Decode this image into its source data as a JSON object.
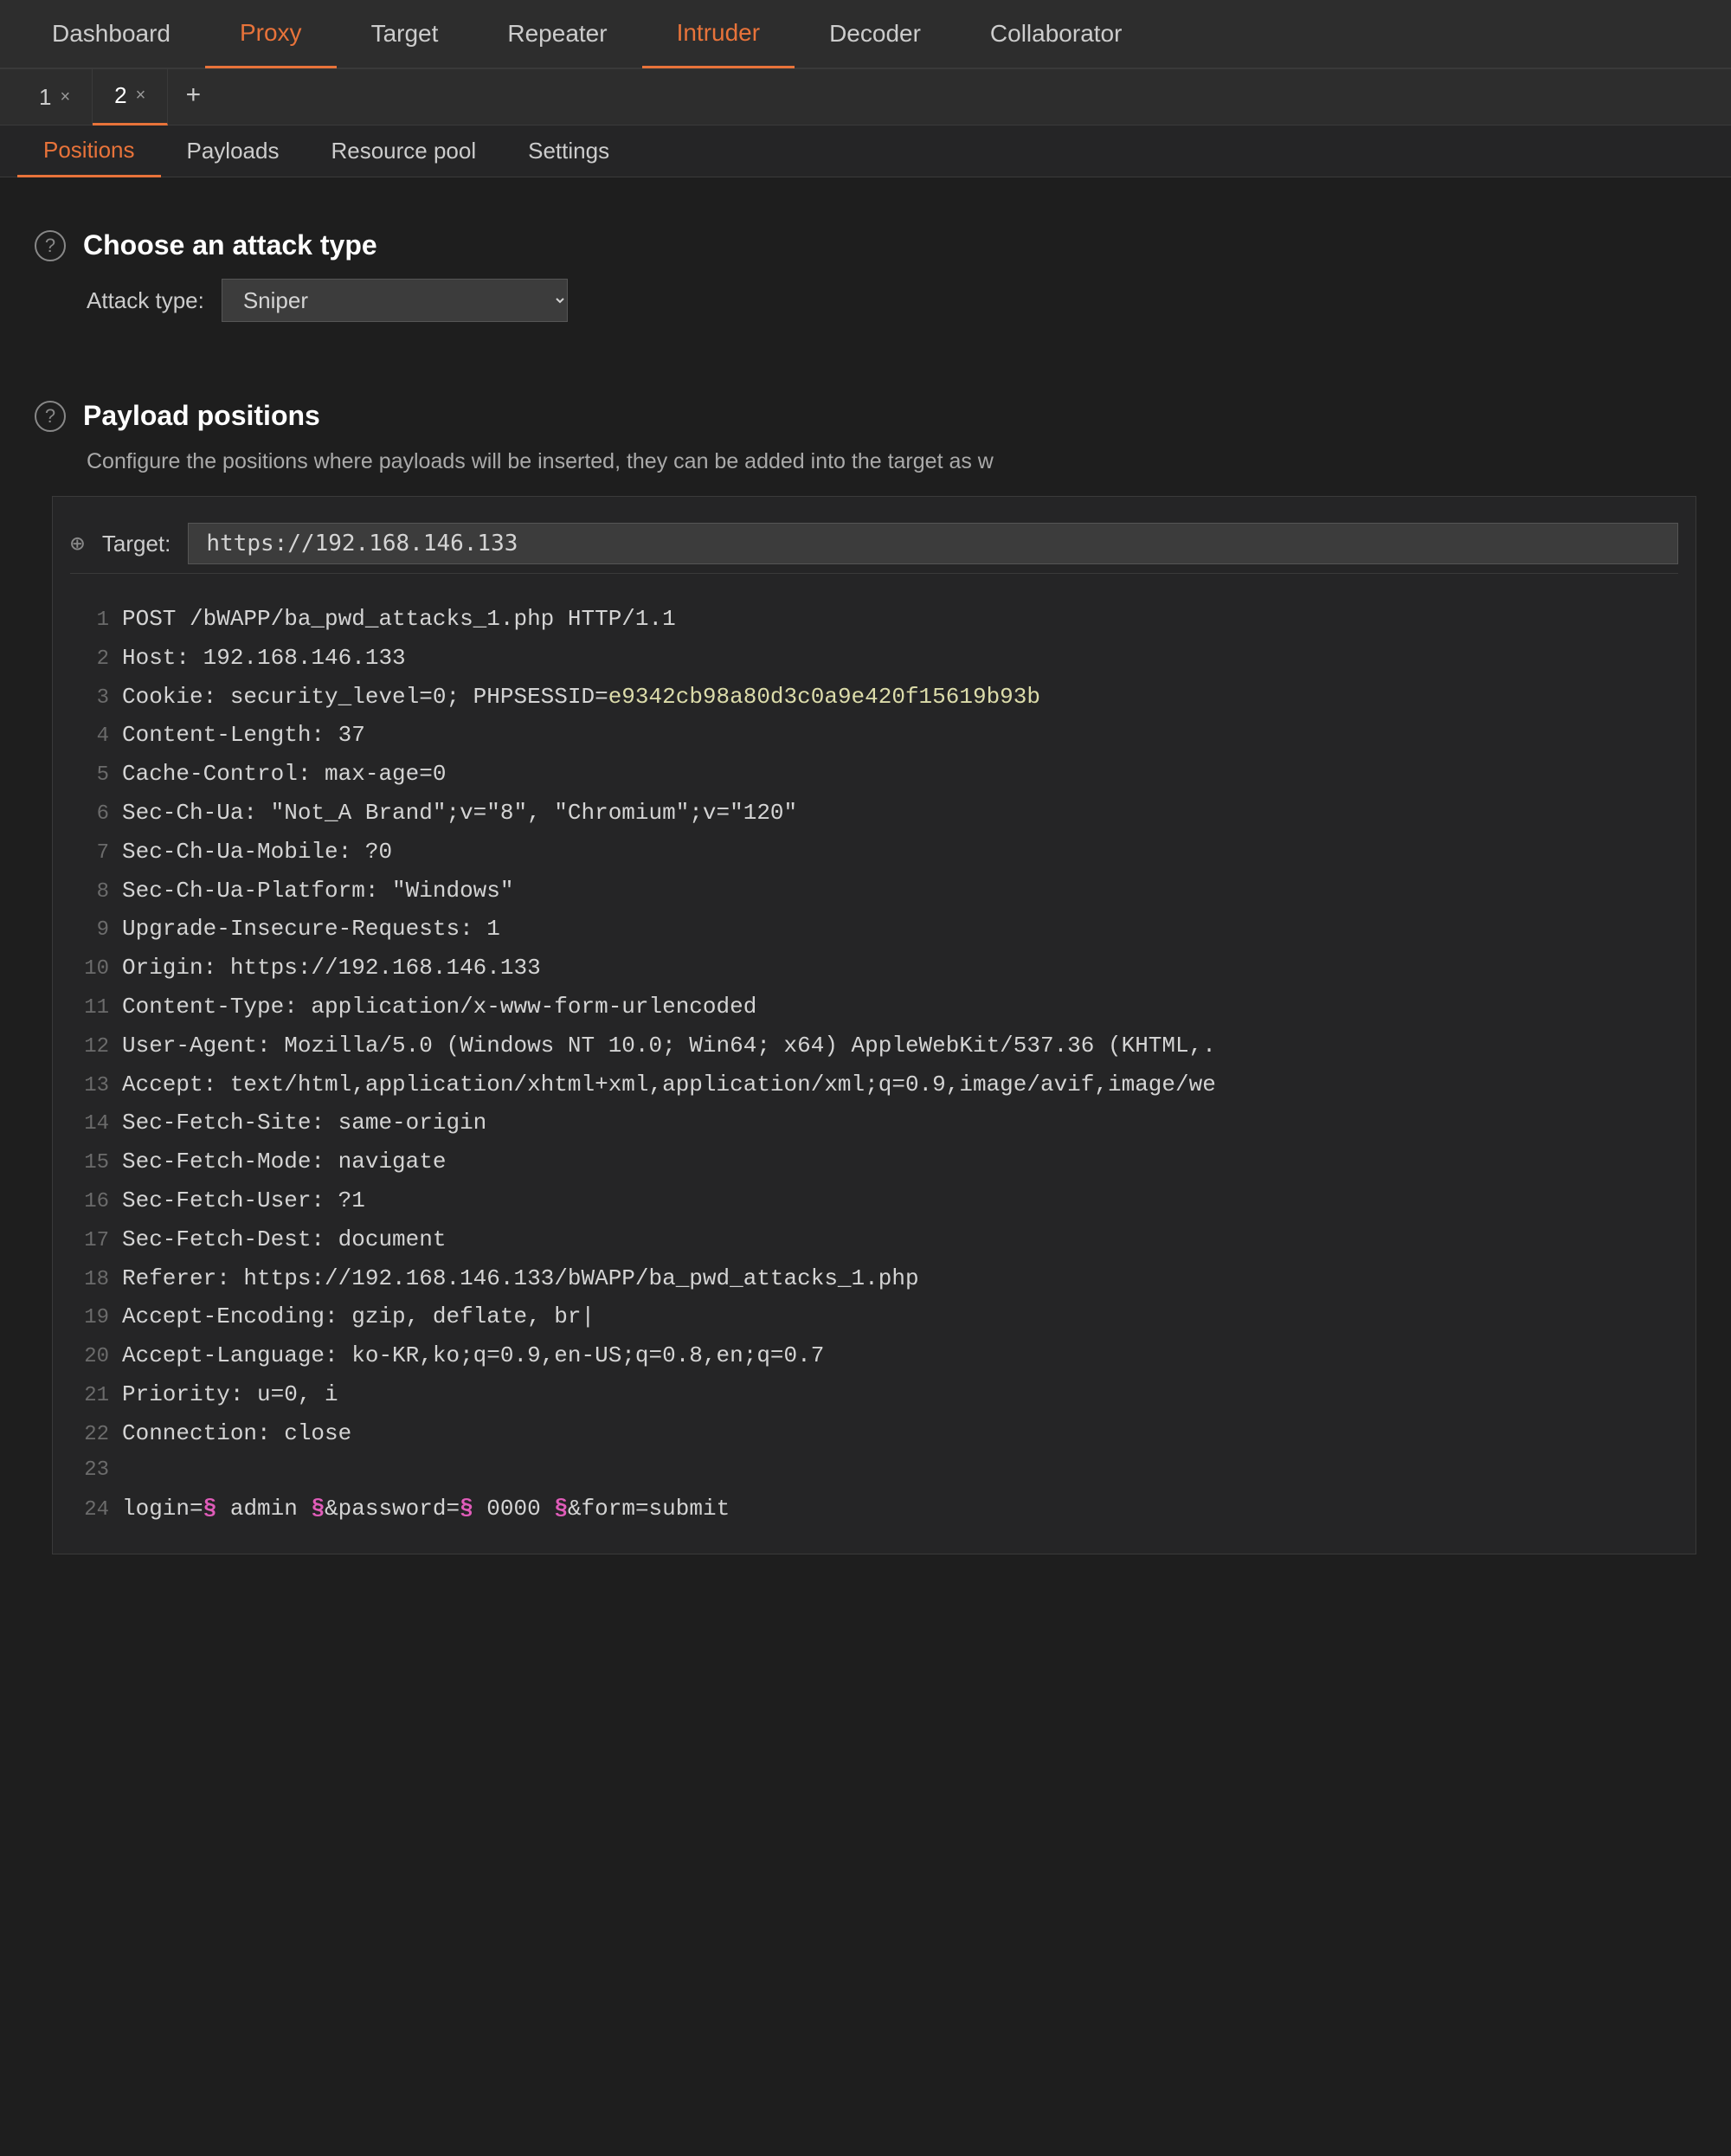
{
  "nav": {
    "items": [
      {
        "label": "Dashboard",
        "active": false
      },
      {
        "label": "Proxy",
        "active": true
      },
      {
        "label": "Target",
        "active": false
      },
      {
        "label": "Repeater",
        "active": false
      },
      {
        "label": "Intruder",
        "active": false
      },
      {
        "label": "Decoder",
        "active": false
      },
      {
        "label": "Collaborator",
        "active": false
      }
    ]
  },
  "tabs": {
    "items": [
      {
        "label": "1",
        "active": false
      },
      {
        "label": "2",
        "active": true
      }
    ],
    "add_label": "+"
  },
  "subtabs": {
    "items": [
      {
        "label": "Positions",
        "active": true
      },
      {
        "label": "Payloads",
        "active": false
      },
      {
        "label": "Resource pool",
        "active": false
      },
      {
        "label": "Settings",
        "active": false
      }
    ]
  },
  "attack_type": {
    "section_title": "Choose an attack type",
    "label": "Attack type:",
    "value": "Sniper"
  },
  "payload_positions": {
    "section_title": "Payload positions",
    "description": "Configure the positions where payloads will be inserted, they can be added into the target as w",
    "target": {
      "label": "Target:",
      "value": "https://192.168.146.133"
    },
    "request_lines": [
      {
        "num": "1",
        "text": "POST /bWAPP/ba_pwd_attacks_1.php HTTP/1.1",
        "type": "plain"
      },
      {
        "num": "2",
        "text": "Host: 192.168.146.133",
        "type": "plain"
      },
      {
        "num": "3",
        "text": "Cookie: security_level=0; PHPSESSID=",
        "suffix": "e9342cb98a80d3c0a9e420f15619b93b",
        "type": "cookie"
      },
      {
        "num": "4",
        "text": "Content-Length: 37",
        "type": "plain"
      },
      {
        "num": "5",
        "text": "Cache-Control: max-age=0",
        "type": "plain"
      },
      {
        "num": "6",
        "text": "Sec-Ch-Ua: \"Not_A Brand\";v=\"8\", \"Chromium\";v=\"120\"",
        "type": "plain"
      },
      {
        "num": "7",
        "text": "Sec-Ch-Ua-Mobile: ?0",
        "type": "plain"
      },
      {
        "num": "8",
        "text": "Sec-Ch-Ua-Platform: \"Windows\"",
        "type": "plain"
      },
      {
        "num": "9",
        "text": "Upgrade-Insecure-Requests: 1",
        "type": "plain"
      },
      {
        "num": "10",
        "text": "Origin: https://192.168.146.133",
        "type": "plain"
      },
      {
        "num": "11",
        "text": "Content-Type: application/x-www-form-urlencoded",
        "type": "plain"
      },
      {
        "num": "12",
        "text": "User-Agent: Mozilla/5.0 (Windows NT 10.0; Win64; x64) AppleWebKit/537.36 (KHTML,.",
        "type": "plain"
      },
      {
        "num": "13",
        "text": "Accept: text/html,application/xhtml+xml,application/xml;q=0.9,image/avif,image/we",
        "type": "plain"
      },
      {
        "num": "14",
        "text": "Sec-Fetch-Site: same-origin",
        "type": "plain"
      },
      {
        "num": "15",
        "text": "Sec-Fetch-Mode: navigate",
        "type": "plain"
      },
      {
        "num": "16",
        "text": "Sec-Fetch-User: ?1",
        "type": "plain"
      },
      {
        "num": "17",
        "text": "Sec-Fetch-Dest: document",
        "type": "plain"
      },
      {
        "num": "18",
        "text": "Referer: https://192.168.146.133/bWAPP/ba_pwd_attacks_1.php",
        "type": "plain"
      },
      {
        "num": "19",
        "text": "Accept-Encoding: gzip, deflate, br|",
        "type": "plain"
      },
      {
        "num": "20",
        "text": "Accept-Language: ko-KR,ko;q=0.9,en-US;q=0.8,en;q=0.7",
        "type": "plain"
      },
      {
        "num": "21",
        "text": "Priority: u=0, i",
        "type": "plain"
      },
      {
        "num": "22",
        "text": "Connection: close",
        "type": "plain"
      },
      {
        "num": "23",
        "text": "",
        "type": "plain"
      },
      {
        "num": "24",
        "text": "login=",
        "suffix_payload1": "§ admin §",
        "mid": "&password=",
        "suffix_payload2": "§ 0000 §",
        "end": "&form=submit",
        "type": "payload_line"
      }
    ]
  }
}
